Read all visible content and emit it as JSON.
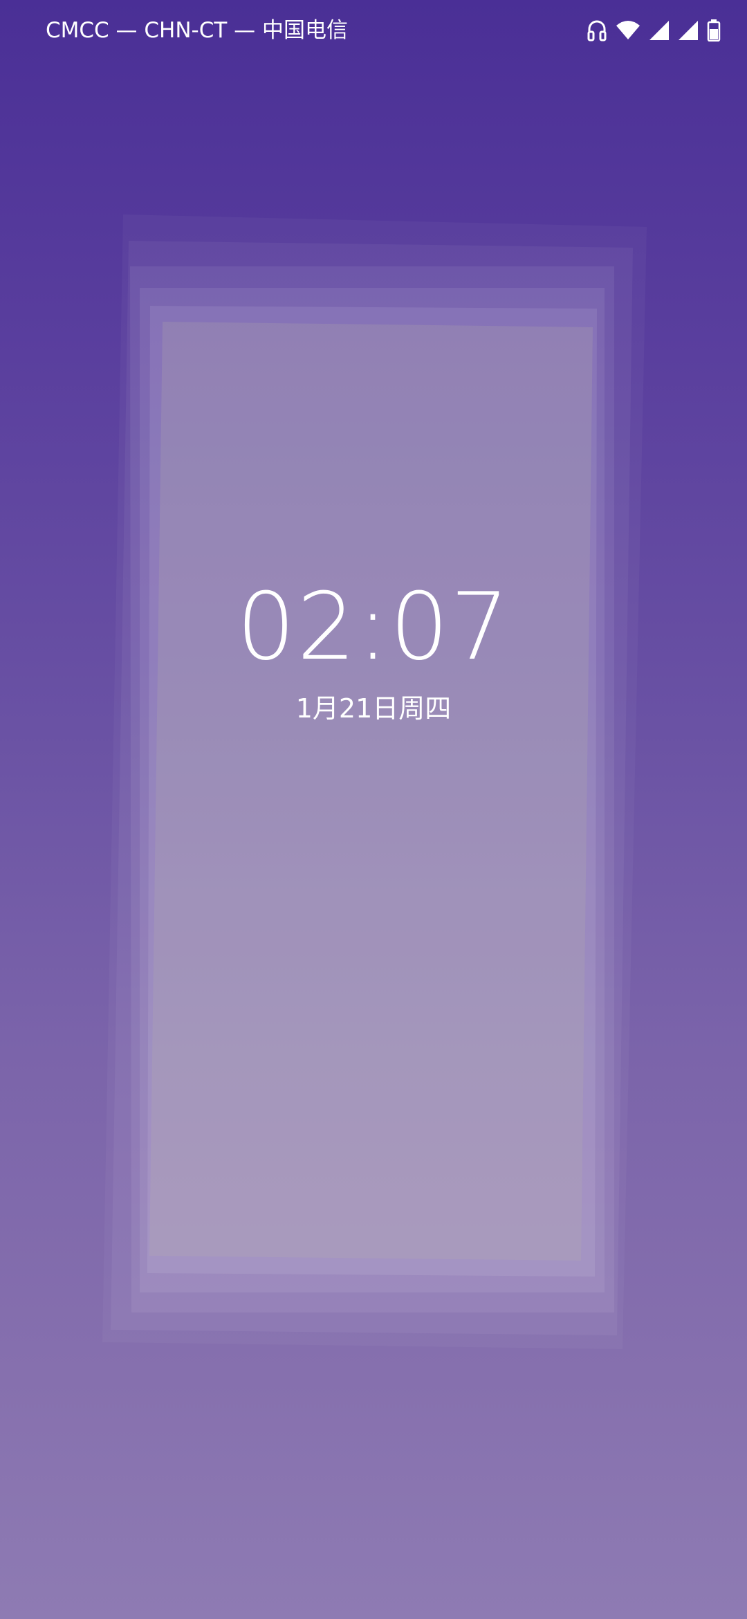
{
  "status_bar": {
    "carrier": "CMCC — CHN-CT — 中国电信",
    "icons": [
      "headset-icon",
      "wifi-icon",
      "cellular-signal-icon",
      "cellular-signal-icon",
      "battery-icon"
    ]
  },
  "lock_screen": {
    "time": "02:07",
    "date": "1月21日周四"
  },
  "colors": {
    "background_top": "#4a2f96",
    "background_bottom": "#8e7bb3",
    "text": "#ffffff"
  }
}
